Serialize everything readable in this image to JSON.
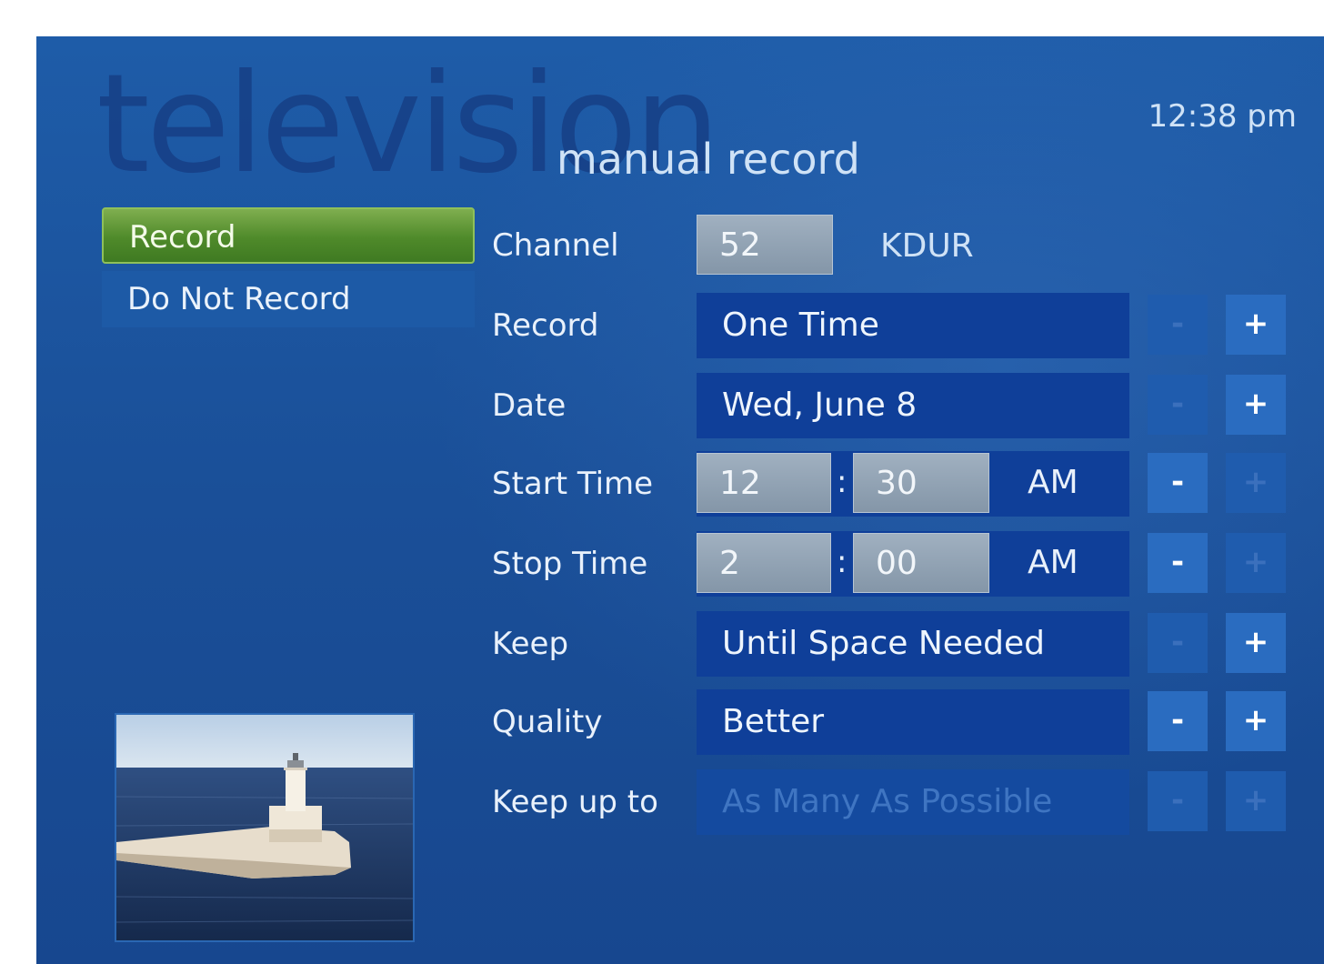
{
  "app": {
    "section_title": "television",
    "page_title": "manual record",
    "clock": "12:38 pm"
  },
  "menu": [
    {
      "label": "Record",
      "selected": true
    },
    {
      "label": "Do Not Record",
      "selected": false
    }
  ],
  "form": {
    "channel": {
      "label": "Channel",
      "number": "52",
      "callsign": "KDUR"
    },
    "record": {
      "label": "Record",
      "value": "One Time"
    },
    "date": {
      "label": "Date",
      "value": "Wed, June 8"
    },
    "start_time": {
      "label": "Start Time",
      "hour": "12",
      "minute": "30",
      "ampm": "AM",
      "separator": ":"
    },
    "stop_time": {
      "label": "Stop Time",
      "hour": "2",
      "minute": "00",
      "ampm": "AM",
      "separator": ":"
    },
    "keep": {
      "label": "Keep",
      "value": "Until Space Needed"
    },
    "quality": {
      "label": "Quality",
      "value": "Better"
    },
    "keep_up_to": {
      "label": "Keep up to",
      "value": "As Many As Possible",
      "disabled": true
    }
  },
  "stepper": {
    "minus": "-",
    "plus": "+"
  },
  "colors": {
    "background": "#1a4f98",
    "selected_green": "#4f8a2a",
    "value_field": "#0f3f99",
    "numeric_field": "#8496a8",
    "button_active": "#2a6cc0"
  }
}
